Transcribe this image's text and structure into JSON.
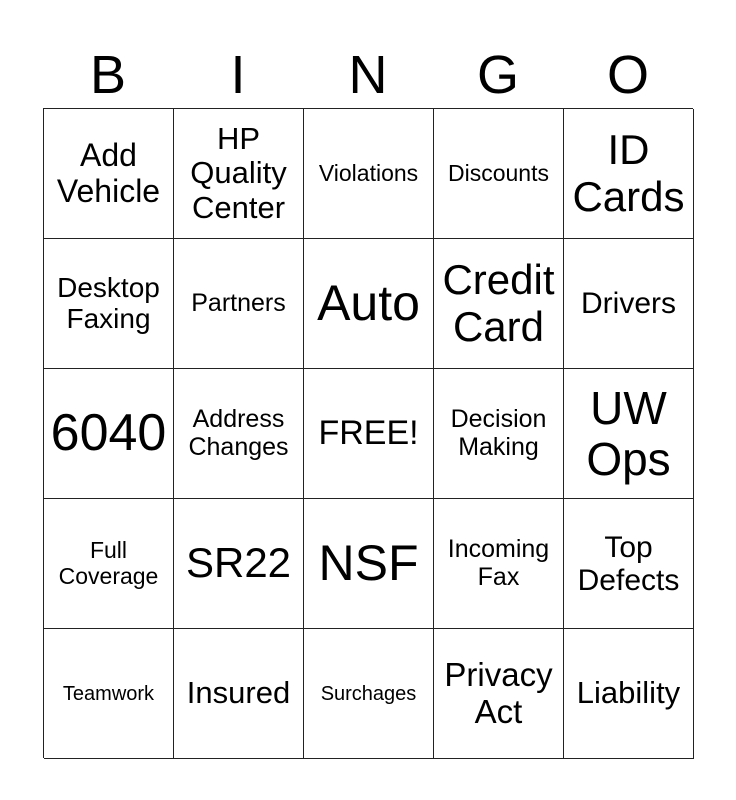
{
  "header": [
    "B",
    "I",
    "N",
    "G",
    "O"
  ],
  "cells": [
    [
      "Add\nVehicle",
      "HP\nQuality\nCenter",
      "Violations",
      "Discounts",
      "ID\nCards"
    ],
    [
      "Desktop\nFaxing",
      "Partners",
      "Auto",
      "Credit\nCard",
      "Drivers"
    ],
    [
      "6040",
      "Address\nChanges",
      "FREE!",
      "Decision\nMaking",
      "UW\nOps"
    ],
    [
      "Full\nCoverage",
      "SR22",
      "NSF",
      "Incoming\nFax",
      "Top\nDefects"
    ],
    [
      "Teamwork",
      "Insured",
      "Surchages",
      "Privacy\nAct",
      "Liability"
    ]
  ]
}
